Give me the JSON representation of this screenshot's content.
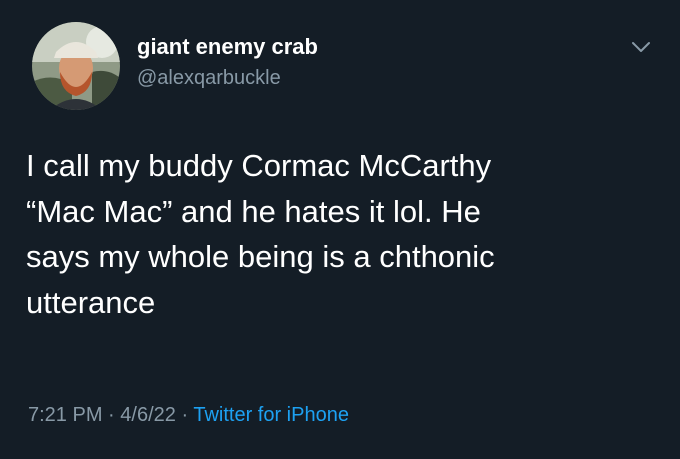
{
  "author": {
    "display_name": "giant enemy crab",
    "handle": "@alexqarbuckle"
  },
  "tweet": {
    "lines": [
      "I call my buddy Cormac McCarthy",
      "“Mac Mac” and he hates it lol. He",
      "says my whole being is a chthonic",
      "utterance"
    ],
    "time": "7:21 PM",
    "date": "4/6/22",
    "separator": "·",
    "source": "Twitter for iPhone"
  },
  "icons": {
    "menu": "chevron-down-icon"
  },
  "colors": {
    "background": "#141d26",
    "primary_text": "#ffffff",
    "secondary_text": "#8899a6",
    "link": "#1da1f2"
  }
}
